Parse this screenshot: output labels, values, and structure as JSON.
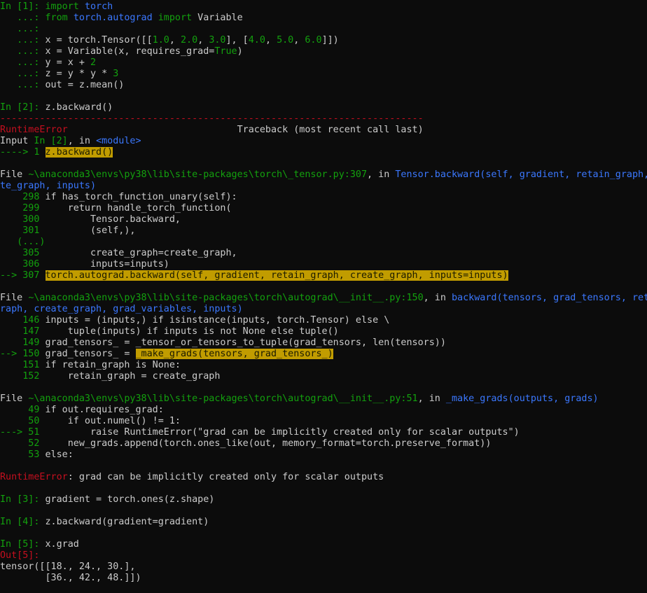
{
  "colors": {
    "background": "#0c0c0c",
    "text": "#cccccc",
    "prompt_in": "#13a10e",
    "prompt_out": "#c50f1f",
    "keyword": "#13a10e",
    "number": "#13a10e",
    "error": "#c50f1f",
    "link": "#3b78ff",
    "highlight": "#c19c00"
  },
  "lines": [
    [
      {
        "t": "In [1]: ",
        "c": "g"
      },
      {
        "t": "import",
        "c": "g"
      },
      {
        "t": " "
      },
      {
        "t": "torch",
        "c": "b"
      }
    ],
    [
      {
        "t": "   ...: ",
        "c": "g"
      },
      {
        "t": "from",
        "c": "g"
      },
      {
        "t": " "
      },
      {
        "t": "torch.autograd",
        "c": "b"
      },
      {
        "t": " "
      },
      {
        "t": "import",
        "c": "g"
      },
      {
        "t": " Variable"
      }
    ],
    [
      {
        "t": "   ...:",
        "c": "g"
      }
    ],
    [
      {
        "t": "   ...: ",
        "c": "g"
      },
      {
        "t": "x = torch.Tensor([["
      },
      {
        "t": "1.0",
        "c": "g"
      },
      {
        "t": ", "
      },
      {
        "t": "2.0",
        "c": "g"
      },
      {
        "t": ", "
      },
      {
        "t": "3.0",
        "c": "g"
      },
      {
        "t": "], ["
      },
      {
        "t": "4.0",
        "c": "g"
      },
      {
        "t": ", "
      },
      {
        "t": "5.0",
        "c": "g"
      },
      {
        "t": ", "
      },
      {
        "t": "6.0",
        "c": "g"
      },
      {
        "t": "]])"
      }
    ],
    [
      {
        "t": "   ...: ",
        "c": "g"
      },
      {
        "t": "x = Variable(x, requires_grad="
      },
      {
        "t": "True",
        "c": "g"
      },
      {
        "t": ")"
      }
    ],
    [
      {
        "t": "   ...: ",
        "c": "g"
      },
      {
        "t": "y = x + "
      },
      {
        "t": "2",
        "c": "g"
      }
    ],
    [
      {
        "t": "   ...: ",
        "c": "g"
      },
      {
        "t": "z = y * y * "
      },
      {
        "t": "3",
        "c": "g"
      }
    ],
    [
      {
        "t": "   ...: ",
        "c": "g"
      },
      {
        "t": "out = z.mean()"
      }
    ],
    [],
    [
      {
        "t": "In [2]: ",
        "c": "g"
      },
      {
        "t": "z.backward()"
      }
    ],
    [
      {
        "t": "---------------------------------------------------------------------------",
        "c": "r"
      }
    ],
    [
      {
        "t": "RuntimeError",
        "c": "r"
      },
      {
        "t": "                              Traceback (most recent call last)"
      }
    ],
    [
      {
        "t": "Input "
      },
      {
        "t": "In [2]",
        "c": "g"
      },
      {
        "t": ", in "
      },
      {
        "t": "<module>",
        "c": "b"
      }
    ],
    [
      {
        "t": "----> 1 ",
        "c": "g"
      },
      {
        "t": "z.backward()",
        "c": "h"
      }
    ],
    [],
    [
      {
        "t": "File "
      },
      {
        "t": "~\\anaconda3\\envs\\py38\\lib\\site-packages\\torch\\_tensor.py:307",
        "c": "g"
      },
      {
        "t": ", in "
      },
      {
        "t": "Tensor.backward(self, gradient, retain_graph, create_graph, inputs)",
        "c": "b"
      }
    ],
    [
      {
        "t": "te_graph, inputs)",
        "c": "b"
      }
    ],
    [
      {
        "t": "    298 ",
        "c": "g"
      },
      {
        "t": "if has_torch_function_unary(self):"
      }
    ],
    [
      {
        "t": "    299 ",
        "c": "g"
      },
      {
        "t": "    return handle_torch_function("
      }
    ],
    [
      {
        "t": "    300 ",
        "c": "g"
      },
      {
        "t": "        Tensor.backward,"
      }
    ],
    [
      {
        "t": "    301 ",
        "c": "g"
      },
      {
        "t": "        (self,),"
      }
    ],
    [
      {
        "t": "   (...)",
        "c": "g"
      }
    ],
    [
      {
        "t": "    305 ",
        "c": "g"
      },
      {
        "t": "        create_graph=create_graph,"
      }
    ],
    [
      {
        "t": "    306 ",
        "c": "g"
      },
      {
        "t": "        inputs=inputs)"
      }
    ],
    [
      {
        "t": "--> 307 ",
        "c": "g"
      },
      {
        "t": "torch.autograd.backward(self, gradient, retain_graph, create_graph, inputs=inputs)",
        "c": "h"
      }
    ],
    [],
    [
      {
        "t": "File "
      },
      {
        "t": "~\\anaconda3\\envs\\py38\\lib\\site-packages\\torch\\autograd\\__init__.py:150",
        "c": "g"
      },
      {
        "t": ", in "
      },
      {
        "t": "backward(tensors, grad_tensors, retain_graph, create_graph, grad_variables, inputs)",
        "c": "b"
      }
    ],
    [
      {
        "t": "raph, create_graph, grad_variables, inputs)",
        "c": "b"
      }
    ],
    [
      {
        "t": "    146 ",
        "c": "g"
      },
      {
        "t": "inputs = (inputs,) if isinstance(inputs, torch.Tensor) else \\"
      }
    ],
    [
      {
        "t": "    147 ",
        "c": "g"
      },
      {
        "t": "    tuple(inputs) if inputs is not None else tuple()"
      }
    ],
    [
      {
        "t": "    149 ",
        "c": "g"
      },
      {
        "t": "grad_tensors_ = _tensor_or_tensors_to_tuple(grad_tensors, len(tensors))"
      }
    ],
    [
      {
        "t": "--> 150 ",
        "c": "g"
      },
      {
        "t": "grad_tensors_ = "
      },
      {
        "t": "_make_grads(tensors, grad_tensors_)",
        "c": "h"
      }
    ],
    [
      {
        "t": "    151 ",
        "c": "g"
      },
      {
        "t": "if retain_graph is None:"
      }
    ],
    [
      {
        "t": "    152 ",
        "c": "g"
      },
      {
        "t": "    retain_graph = create_graph"
      }
    ],
    [],
    [
      {
        "t": "File "
      },
      {
        "t": "~\\anaconda3\\envs\\py38\\lib\\site-packages\\torch\\autograd\\__init__.py:51",
        "c": "g"
      },
      {
        "t": ", in "
      },
      {
        "t": "_make_grads(outputs, grads)",
        "c": "b"
      }
    ],
    [
      {
        "t": "     49 ",
        "c": "g"
      },
      {
        "t": "if out.requires_grad:"
      }
    ],
    [
      {
        "t": "     50 ",
        "c": "g"
      },
      {
        "t": "    if out.numel() != 1:"
      }
    ],
    [
      {
        "t": "---> 51 ",
        "c": "g"
      },
      {
        "t": "        raise RuntimeError(\"grad can be implicitly created only for scalar outputs\")"
      }
    ],
    [
      {
        "t": "     52 ",
        "c": "g"
      },
      {
        "t": "    new_grads.append(torch.ones_like(out, memory_format=torch.preserve_format))"
      }
    ],
    [
      {
        "t": "     53 ",
        "c": "g"
      },
      {
        "t": "else:"
      }
    ],
    [],
    [
      {
        "t": "RuntimeError",
        "c": "r"
      },
      {
        "t": ": grad can be implicitly created only for scalar outputs"
      }
    ],
    [],
    [
      {
        "t": "In [3]: ",
        "c": "g"
      },
      {
        "t": "gradient = torch.ones(z.shape)"
      }
    ],
    [],
    [
      {
        "t": "In [4]: ",
        "c": "g"
      },
      {
        "t": "z.backward(gradient=gradient)"
      }
    ],
    [],
    [
      {
        "t": "In [5]: ",
        "c": "g"
      },
      {
        "t": "x.grad"
      }
    ],
    [
      {
        "t": "Out[5]:",
        "c": "r"
      }
    ],
    [
      {
        "t": "tensor([[18., 24., 30.],"
      }
    ],
    [
      {
        "t": "        [36., 42., 48.]])"
      }
    ]
  ]
}
